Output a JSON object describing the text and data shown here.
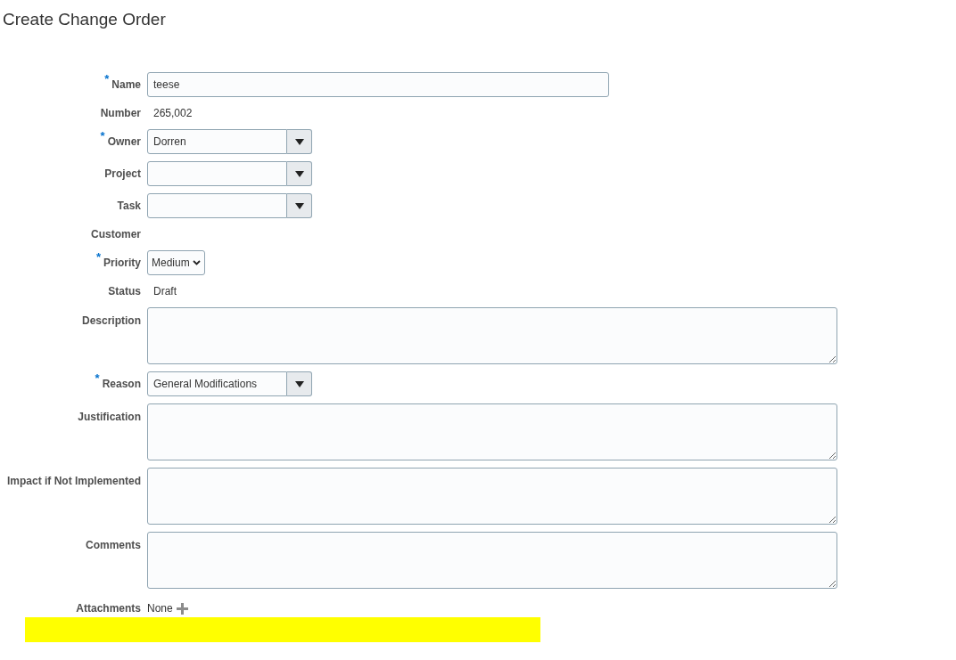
{
  "title": "Create Change Order",
  "fields": [
    {
      "kind": "text",
      "label": "Name",
      "marker": "*",
      "value": "teese"
    },
    {
      "kind": "readonly",
      "label": "Number",
      "value": "265,002"
    },
    {
      "kind": "combo",
      "label": "Owner",
      "marker": "*",
      "value": "Dorren"
    },
    {
      "kind": "combo",
      "label": "Project"
    },
    {
      "kind": "combo",
      "label": "Task"
    },
    {
      "kind": "readonly",
      "label": "Customer"
    },
    {
      "kind": "select",
      "label": "Priority",
      "marker": "*",
      "value": "Medium"
    },
    {
      "kind": "readonly",
      "label": "Status",
      "value": "Draft"
    },
    {
      "kind": "textarea",
      "label": "Description"
    },
    {
      "kind": "combo",
      "label": "Reason",
      "marker": "*",
      "value": "General Modifications"
    },
    {
      "kind": "textarea",
      "label": "Justification"
    },
    {
      "kind": "textarea",
      "label": "Impact if Not Implemented"
    },
    {
      "kind": "textarea",
      "label": "Comments"
    },
    {
      "kind": "attachments",
      "label": "Attachments",
      "value": "None"
    }
  ]
}
